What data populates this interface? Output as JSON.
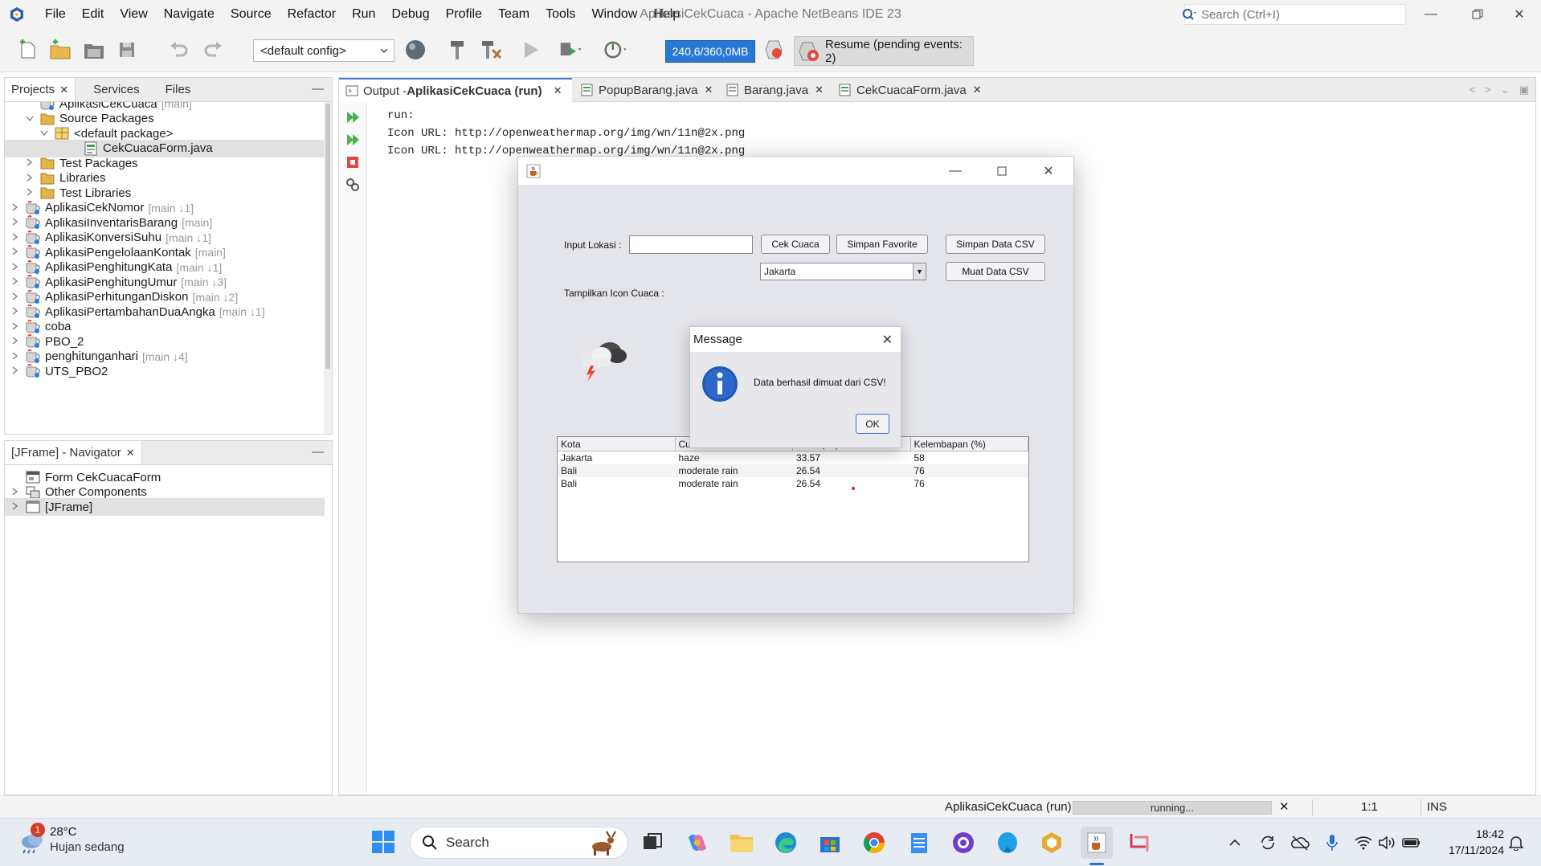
{
  "titlebar": {
    "menu": [
      "File",
      "Edit",
      "View",
      "Navigate",
      "Source",
      "Refactor",
      "Run",
      "Debug",
      "Profile",
      "Team",
      "Tools",
      "Window",
      "Help"
    ],
    "title": "AplikasiCekCuaca - Apache NetBeans IDE 23",
    "search_placeholder": "Search (Ctrl+I)"
  },
  "toolbar": {
    "config": "<default config>",
    "memory": "240,6/360,0MB",
    "resume": "Resume (pending events: 2)"
  },
  "projects_panel": {
    "tabs": [
      "Projects",
      "Services",
      "Files"
    ],
    "tree": [
      {
        "label": "AplikasiCekCuaca",
        "meta": "[main]",
        "indent": 1,
        "caret": "",
        "icon": "project-icon",
        "sel": false
      },
      {
        "label": "Source Packages",
        "meta": "",
        "indent": 1,
        "caret": "v",
        "icon": "folder-icon",
        "sel": false
      },
      {
        "label": "<default package>",
        "meta": "",
        "indent": 2,
        "caret": "v",
        "icon": "package-icon",
        "sel": false
      },
      {
        "label": "CekCuacaForm.java",
        "meta": "",
        "indent": 4,
        "caret": "",
        "icon": "form-file-icon",
        "sel": true
      },
      {
        "label": "Test Packages",
        "meta": "",
        "indent": 1,
        "caret": ">",
        "icon": "folder-icon",
        "sel": false
      },
      {
        "label": "Libraries",
        "meta": "",
        "indent": 1,
        "caret": ">",
        "icon": "folder-icon",
        "sel": false
      },
      {
        "label": "Test Libraries",
        "meta": "",
        "indent": 1,
        "caret": ">",
        "icon": "folder-icon",
        "sel": false
      },
      {
        "label": "AplikasiCekNomor",
        "meta": "[main ↓1]",
        "indent": 0,
        "caret": ">",
        "icon": "project-icon",
        "sel": false
      },
      {
        "label": "AplikasiInventarisBarang",
        "meta": "[main]",
        "indent": 0,
        "caret": ">",
        "icon": "project-icon",
        "sel": false
      },
      {
        "label": "AplikasiKonversiSuhu",
        "meta": "[main ↓1]",
        "indent": 0,
        "caret": ">",
        "icon": "project-icon",
        "sel": false
      },
      {
        "label": "AplikasiPengelolaanKontak",
        "meta": "[main]",
        "indent": 0,
        "caret": ">",
        "icon": "project-icon",
        "sel": false
      },
      {
        "label": "AplikasiPenghitungKata",
        "meta": "[main ↓1]",
        "indent": 0,
        "caret": ">",
        "icon": "project-icon",
        "sel": false
      },
      {
        "label": "AplikasiPenghitungUmur",
        "meta": "[main ↓3]",
        "indent": 0,
        "caret": ">",
        "icon": "project-icon",
        "sel": false
      },
      {
        "label": "AplikasiPerhitunganDiskon",
        "meta": "[main ↓2]",
        "indent": 0,
        "caret": ">",
        "icon": "project-icon",
        "sel": false
      },
      {
        "label": "AplikasiPertambahanDuaAngka",
        "meta": "[main ↓1]",
        "indent": 0,
        "caret": ">",
        "icon": "project-icon",
        "sel": false
      },
      {
        "label": "coba",
        "meta": "",
        "indent": 0,
        "caret": ">",
        "icon": "project-icon",
        "sel": false
      },
      {
        "label": "PBO_2",
        "meta": "",
        "indent": 0,
        "caret": ">",
        "icon": "project-icon",
        "sel": false
      },
      {
        "label": "penghitunganhari",
        "meta": "[main ↓4]",
        "indent": 0,
        "caret": ">",
        "icon": "project-icon",
        "sel": false
      },
      {
        "label": "UTS_PBO2",
        "meta": "",
        "indent": 0,
        "caret": ">",
        "icon": "project-icon",
        "sel": false
      }
    ]
  },
  "navigator_panel": {
    "tab": "[JFrame] - Navigator",
    "tree": [
      {
        "label": "Form CekCuacaForm",
        "indent": 0,
        "caret": "",
        "icon": "form-icon",
        "sel": false
      },
      {
        "label": "Other Components",
        "indent": 0,
        "caret": ">",
        "icon": "components-icon",
        "sel": false
      },
      {
        "label": "[JFrame]",
        "indent": 0,
        "caret": ">",
        "icon": "frame-icon",
        "sel": true
      }
    ]
  },
  "output_panel": {
    "tabs": [
      {
        "prefix": "Output - ",
        "bold": "AplikasiCekCuaca (run)"
      },
      {
        "prefix": "PopupBarang.java",
        "bold": ""
      },
      {
        "prefix": "Barang.java",
        "bold": ""
      },
      {
        "prefix": "CekCuacaForm.java",
        "bold": ""
      }
    ],
    "console": [
      "run:",
      "Icon URL: http://openweathermap.org/img/wn/11n@2x.png",
      "Icon URL: http://openweathermap.org/img/wn/11n@2x.png"
    ]
  },
  "java_window": {
    "input_label": "Input Lokasi :",
    "cek_button": "Cek Cuaca",
    "simpan_favorite_button": "Simpan Favorite",
    "simpan_csv_button": "Simpan Data CSV",
    "muat_csv_button": "Muat Data CSV",
    "combo_value": "Jakarta",
    "icon_label": "Tampilkan Icon Cuaca :",
    "table": {
      "headers": [
        "Kota",
        "Cuaca",
        "Suhu (°C)",
        "Kelembapan (%)"
      ],
      "rows": [
        [
          "Jakarta",
          "haze",
          "33.57",
          "58"
        ],
        [
          "Bali",
          "moderate rain",
          "26.54",
          "76"
        ],
        [
          "Bali",
          "moderate rain",
          "26.54",
          "76"
        ]
      ]
    }
  },
  "message_dialog": {
    "title": "Message",
    "text": "Data berhasil dimuat dari CSV!",
    "ok": "OK"
  },
  "statusbar": {
    "task": "AplikasiCekCuaca (run)",
    "progress": "running...",
    "position": "1:1",
    "mode": "INS"
  },
  "taskbar": {
    "weather_badge": "1",
    "temperature": "28°C",
    "condition": "Hujan sedang",
    "search": "Search",
    "time": "18:42",
    "date": "17/11/2024"
  }
}
